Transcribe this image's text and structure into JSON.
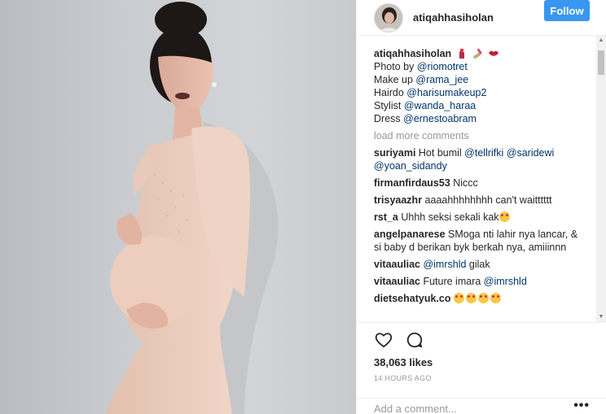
{
  "post": {
    "image_alt": "",
    "author": "atiqahhasiholan",
    "follow_label": "Follow"
  },
  "caption": {
    "username": "atiqahhasiholan",
    "emoji_icons": [
      "lipstick-icon",
      "nail-polish-icon",
      "lips-icon"
    ],
    "lines": [
      {
        "prefix": "Photo by ",
        "mention": "@riomotret"
      },
      {
        "prefix": "Make up ",
        "mention": "@rama_jee"
      },
      {
        "prefix": "Hairdo ",
        "mention": "@harisumakeup2"
      },
      {
        "prefix": "Stylist ",
        "mention": "@wanda_haraa"
      },
      {
        "prefix": "Dress ",
        "mention": "@ernestoabram"
      }
    ]
  },
  "load_more": "load more comments",
  "comments": [
    {
      "user": "suriyami",
      "parts": [
        {
          "t": "text",
          "v": " Hot bumil "
        },
        {
          "t": "mention",
          "v": "@tellrifki"
        },
        {
          "t": "text",
          "v": " "
        },
        {
          "t": "mention",
          "v": "@saridewi"
        },
        {
          "t": "text",
          "v": " "
        },
        {
          "t": "mention",
          "v": "@yoan_sidandy"
        }
      ]
    },
    {
      "user": "firmanfirdaus53",
      "parts": [
        {
          "t": "text",
          "v": " Niccc"
        }
      ]
    },
    {
      "user": "trisyaazhr",
      "parts": [
        {
          "t": "text",
          "v": " aaaahhhhhhhh can't waitttttt"
        }
      ]
    },
    {
      "user": "rst_a",
      "parts": [
        {
          "t": "text",
          "v": " Uhhh seksi sekali kak"
        }
      ],
      "emojis": 1
    },
    {
      "user": "angelpanarese",
      "parts": [
        {
          "t": "text",
          "v": " SMoga nti lahir nya lancar, & si baby d berikan byk berkah nya, amiiinnn"
        }
      ]
    },
    {
      "user": "vitaauliac",
      "parts": [
        {
          "t": "mention",
          "v": " @imrshld"
        },
        {
          "t": "text",
          "v": " gilak"
        }
      ]
    },
    {
      "user": "vitaauliac",
      "parts": [
        {
          "t": "text",
          "v": " Future imara "
        },
        {
          "t": "mention",
          "v": "@imrshld"
        }
      ]
    },
    {
      "user": "dietsehatyuk.co",
      "parts": [
        {
          "t": "text",
          "v": " "
        }
      ],
      "emojis": 4
    }
  ],
  "likes": "38,063 likes",
  "time_ago": "14 HOURS AGO",
  "add_comment_placeholder": "Add a comment...",
  "more_label": "•••",
  "colors": {
    "follow": "#3897f0",
    "mention": "#003569",
    "muted": "#999999"
  }
}
